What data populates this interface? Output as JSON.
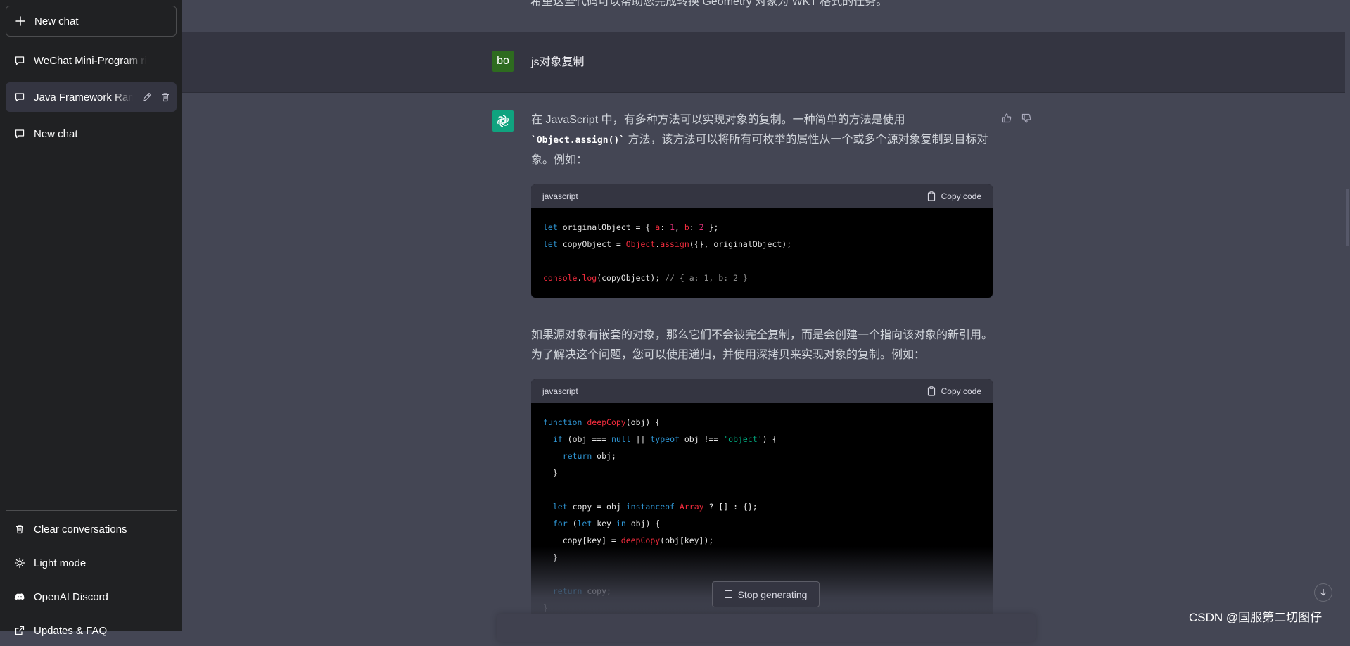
{
  "sidebar": {
    "new_chat": "New chat",
    "conversations": [
      {
        "label": "WeChat Mini-Program rich-t"
      },
      {
        "label": "Java Framework Rankings"
      },
      {
        "label": "New chat"
      }
    ],
    "bottom": {
      "clear": "Clear conversations",
      "light_mode": "Light mode",
      "discord": "OpenAI Discord",
      "updates": "Updates & FAQ"
    }
  },
  "main": {
    "truncated_top_text": "希望这些代码可以帮助您完成转换 Geometry 对象为 WKT 格式的任务。",
    "user": {
      "avatar": "bo",
      "message": "js对象复制"
    },
    "answer": {
      "p1_before": "在 JavaScript 中，有多种方法可以实现对象的复制。一种简单的方法是使用",
      "p1_code": "`Object.assign()`",
      "p1_after": " 方法，该方法可以将所有可枚举的属性从一个或多个源对象复制到目标对象。例如：",
      "code1_lang": "javascript",
      "copy_label": "Copy code",
      "p2": "如果源对象有嵌套的对象，那么它们不会被完全复制，而是会创建一个指向该对象的新引用。为了解决这个问题，您可以使用递归，并使用深拷贝来实现对象的复制。例如：",
      "code2_lang": "javascript"
    },
    "stop_generating": "Stop generating"
  },
  "watermark": "CSDN @国服第二切图仔"
}
